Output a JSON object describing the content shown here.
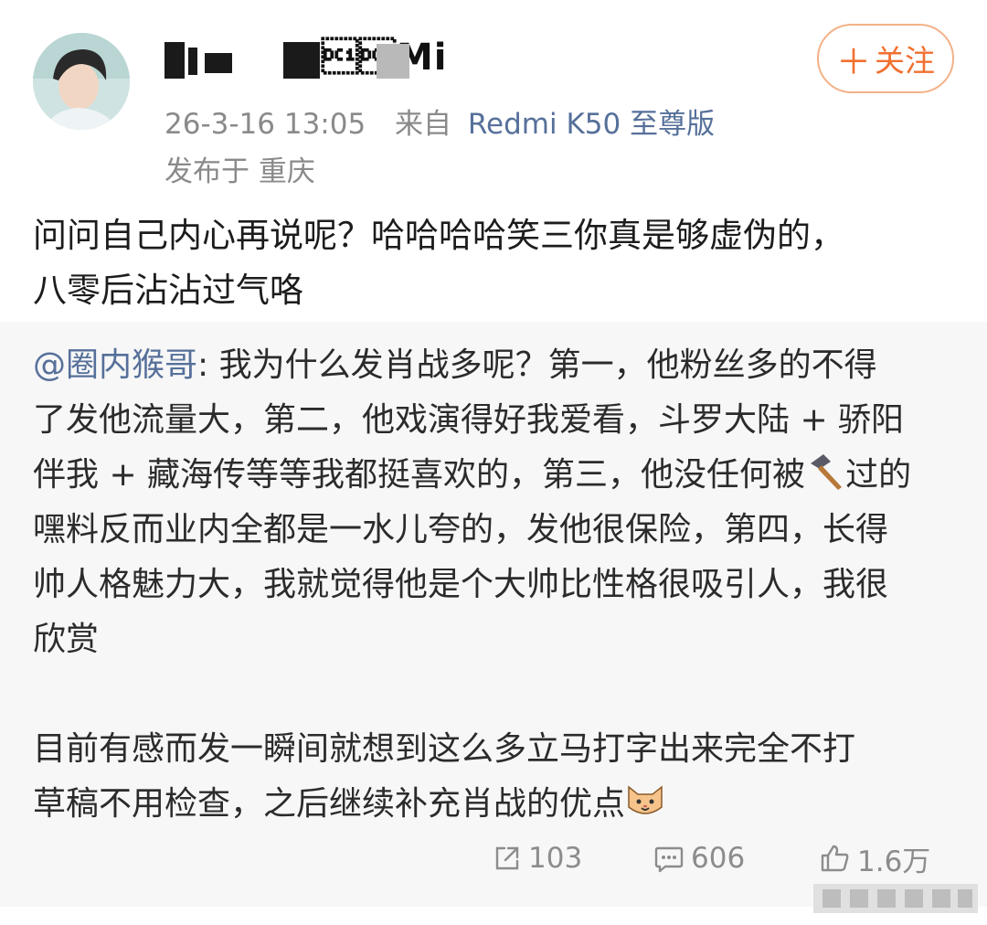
{
  "post": {
    "username": "\u0011\u0014Mi",
    "follow_label": "关注",
    "timestamp": "26-3-16 13:05",
    "source_prefix": "来自",
    "device": "Redmi K50 至尊版",
    "location": "发布于 重庆",
    "text_line1": "问问自己内心再说呢？哈哈哈哈笑三你真是够虚伪的，",
    "text_line2": "八零后沾沾过气咯"
  },
  "quoted": {
    "mention": "@圈内猴哥",
    "line1_rest": ": 我为什么发肖战多呢？第一，他粉丝多的不得",
    "line2": "了发他流量大，第二，他戏演得好我爱看，斗罗大陆 + 骄阳",
    "line3a": "伴我 + 藏海传等等我都挺喜欢的，第三，他没任何被",
    "line3b": "过的",
    "line4": "嘿料反而业内全都是一水儿夸的，发他很保险，第四，长得",
    "line5": "帅人格魅力大，我就觉得他是个大帅比性格很吸引人，我很",
    "line6": "欣赏",
    "line7": "目前有感而发一瞬间就想到这么多立马打字出来完全不打",
    "line8": "草稿不用检查，之后继续补充肖战的优点",
    "hammer_icon": "hammer-icon",
    "cat_icon": "cat-face-icon"
  },
  "actions": {
    "repost_count": "103",
    "comment_count": "606",
    "like_count": "1.6万"
  },
  "colors": {
    "accent_orange": "#f07030",
    "link_blue": "#56709a",
    "meta_gray": "#8a8a8a",
    "quote_bg": "#f7f7f7"
  }
}
